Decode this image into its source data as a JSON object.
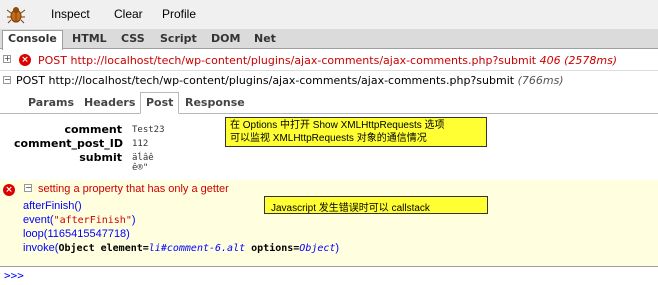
{
  "toolbar": {
    "inspect_label": "Inspect",
    "clear_label": "Clear",
    "profile_label": "Profile"
  },
  "tabs": [
    {
      "label": "Console",
      "active": true
    },
    {
      "label": "HTML",
      "active": false
    },
    {
      "label": "CSS",
      "active": false
    },
    {
      "label": "Script",
      "active": false
    },
    {
      "label": "DOM",
      "active": false
    },
    {
      "label": "Net",
      "active": false
    }
  ],
  "requests": [
    {
      "method": "POST",
      "url": "http://localhost/tech/wp-content/plugins/ajax-comments/ajax-comments.php?submit",
      "status": "406",
      "time": "(2578ms)",
      "error": true
    },
    {
      "method": "POST",
      "url": "http://localhost/tech/wp-content/plugins/ajax-comments/ajax-comments.php?submit",
      "time": "(766ms)",
      "error": false
    }
  ],
  "subtabs": [
    {
      "label": "Params",
      "active": false
    },
    {
      "label": "Headers",
      "active": false
    },
    {
      "label": "Post",
      "active": true
    },
    {
      "label": "Response",
      "active": false
    }
  ],
  "post": [
    {
      "key": "comment",
      "value": "Test23"
    },
    {
      "key": "comment_post_ID",
      "value": "112"
    },
    {
      "key": "submit",
      "value": "äĺâê ê®\""
    }
  ],
  "notes": {
    "options_note_line1": "在 Options 中打开 Show XMLHttpRequests 选项",
    "options_note_line2": "可以监视 XMLHttpRequests 对象的通信情况",
    "callstack_note": "Javascript 发生错误时可以 callstack"
  },
  "error": {
    "message": "setting a property that has only a getter",
    "stack": {
      "line1": "afterFinish()",
      "line2_fn": "event(",
      "line2_arg": "\"afterFinish\"",
      "line2_end": ")",
      "line3": "loop(1165415547718)",
      "line4_fn": "invoke(",
      "line4_obj1": "Object element=",
      "line4_val1": "li#comment-6.alt",
      "line4_obj2": " options=",
      "line4_val2": "Object",
      "line4_end": ")"
    }
  },
  "command_line": {
    "prompt": ">>>"
  },
  "colors": {
    "error_red": "#cc0000",
    "note_yellow": "#ffff33",
    "stack_blue": "#0000ff",
    "error_bg": "#ffffe0"
  }
}
